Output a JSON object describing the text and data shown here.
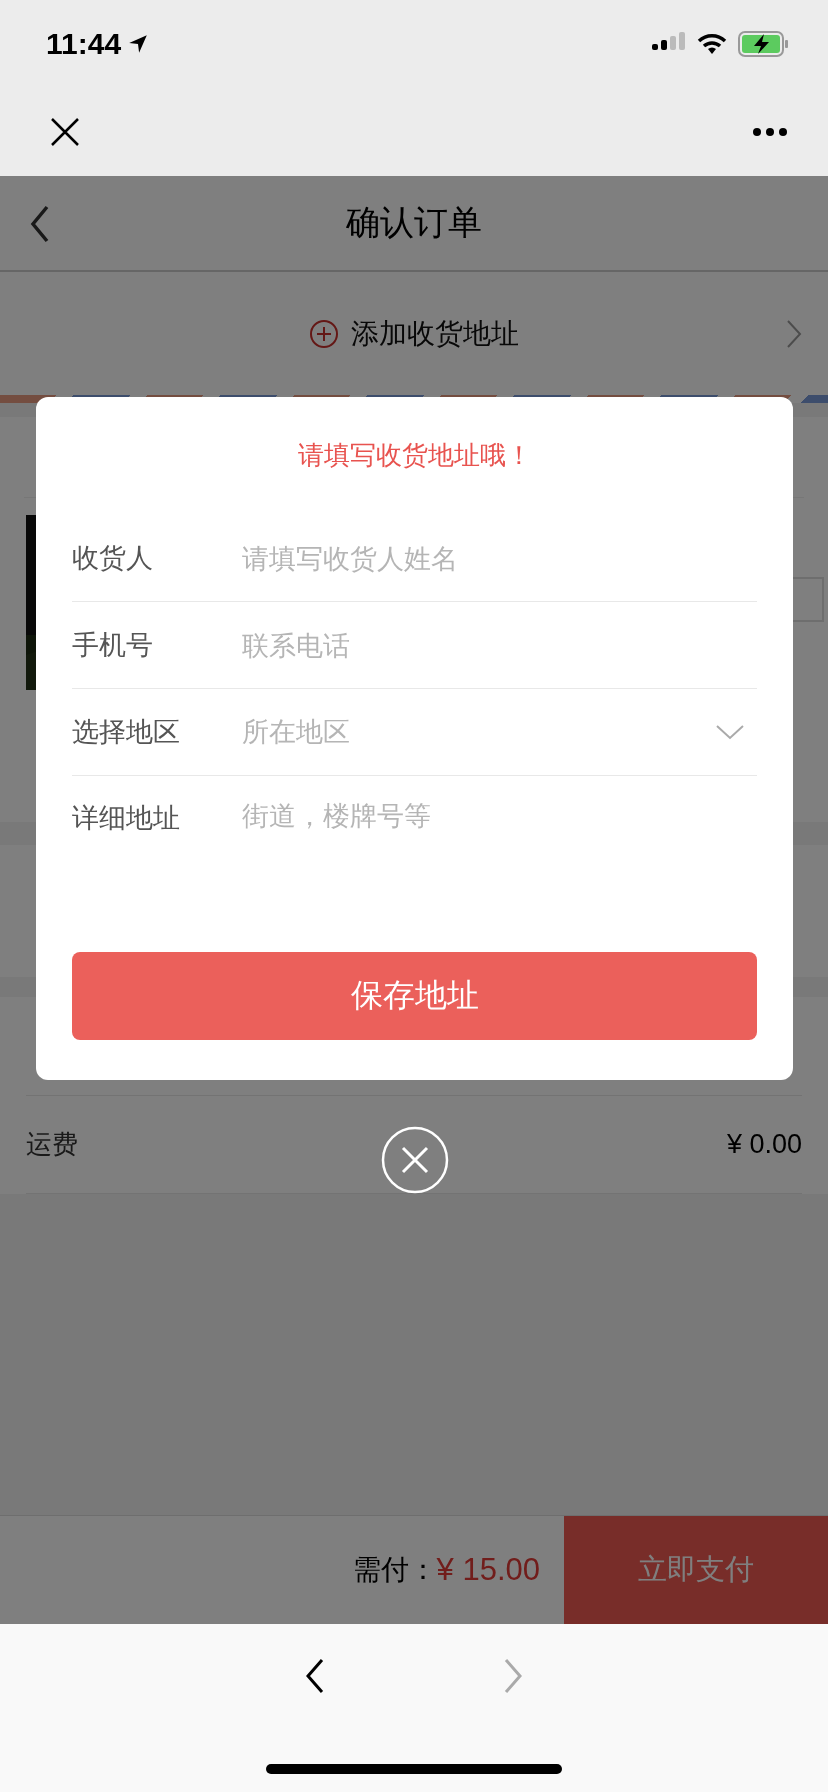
{
  "status_bar": {
    "time": "11:44"
  },
  "header": {
    "title": "确认订单"
  },
  "address": {
    "label": "添加收货地址"
  },
  "summary_rows": [
    {
      "label": "运费",
      "value": "¥ 0.00"
    }
  ],
  "footer": {
    "due_label": "需付：",
    "due_amount": "¥ 15.00",
    "pay_button": "立即支付"
  },
  "dialog": {
    "title": "请填写收货地址哦！",
    "fields": [
      {
        "kind": "text",
        "label": "收货人",
        "placeholder": "请填写收货人姓名"
      },
      {
        "kind": "text",
        "label": "手机号",
        "placeholder": "联系电话"
      },
      {
        "kind": "select",
        "label": "选择地区",
        "placeholder": "所在地区"
      },
      {
        "kind": "text",
        "label": "详细地址",
        "placeholder": "街道，楼牌号等"
      }
    ],
    "save_button": "保存地址"
  }
}
